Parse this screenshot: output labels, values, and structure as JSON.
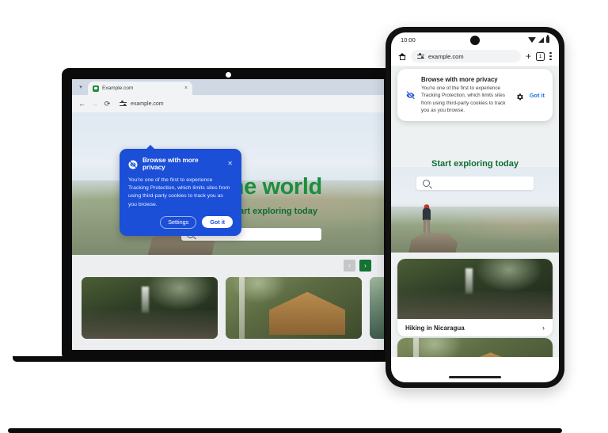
{
  "laptop": {
    "browser": {
      "tab": {
        "title": "Example.com",
        "favicon": "globe-icon",
        "close": "×",
        "chevron": "▾"
      },
      "toolbar": {
        "back": "←",
        "forward": "→",
        "reload": "⟳",
        "tune_icon": "tune-icon",
        "url": "example.com"
      }
    },
    "page": {
      "headline": "avel the world",
      "subhead": "Start exploring today",
      "search_placeholder": "",
      "carousel": {
        "prev": "‹",
        "next": "›"
      }
    },
    "tooltip": {
      "icon": "eye-slash-icon",
      "title": "Browse with more privacy",
      "close": "✕",
      "body": "You're one of the first to experience Tracking Protection, which limits sites from using third-party cookies to track you as you browse.",
      "settings_label": "Settings",
      "gotit_label": "Got it"
    }
  },
  "phone": {
    "status": {
      "time": "10:00",
      "wifi": "wifi-icon",
      "signal": "signal-icon",
      "battery": "battery-icon"
    },
    "toolbar": {
      "home": "home-icon",
      "tune_icon": "tune-icon",
      "url": "example.com",
      "new_tab": "+",
      "tab_count": "1",
      "menu": "overflow-menu-icon"
    },
    "dialog": {
      "icon": "eye-slash-icon",
      "title": "Browse with more privacy",
      "body": "You're one of the first to experience Tracking Protection, which limits sites from using third-party cookies to track you as you browse.",
      "settings_icon": "gear-icon",
      "gotit_label": "Got it"
    },
    "page": {
      "subhead": "Start exploring today",
      "search_placeholder": "",
      "cards": [
        {
          "label": "Hiking in Nicaragua",
          "chevron": "›"
        },
        {
          "label": "",
          "chevron": ""
        }
      ]
    }
  },
  "colors": {
    "brand_blue": "#1b4fd8",
    "green": "#1e8e3e",
    "link_blue": "#1a73e8",
    "device_black": "#111111"
  }
}
